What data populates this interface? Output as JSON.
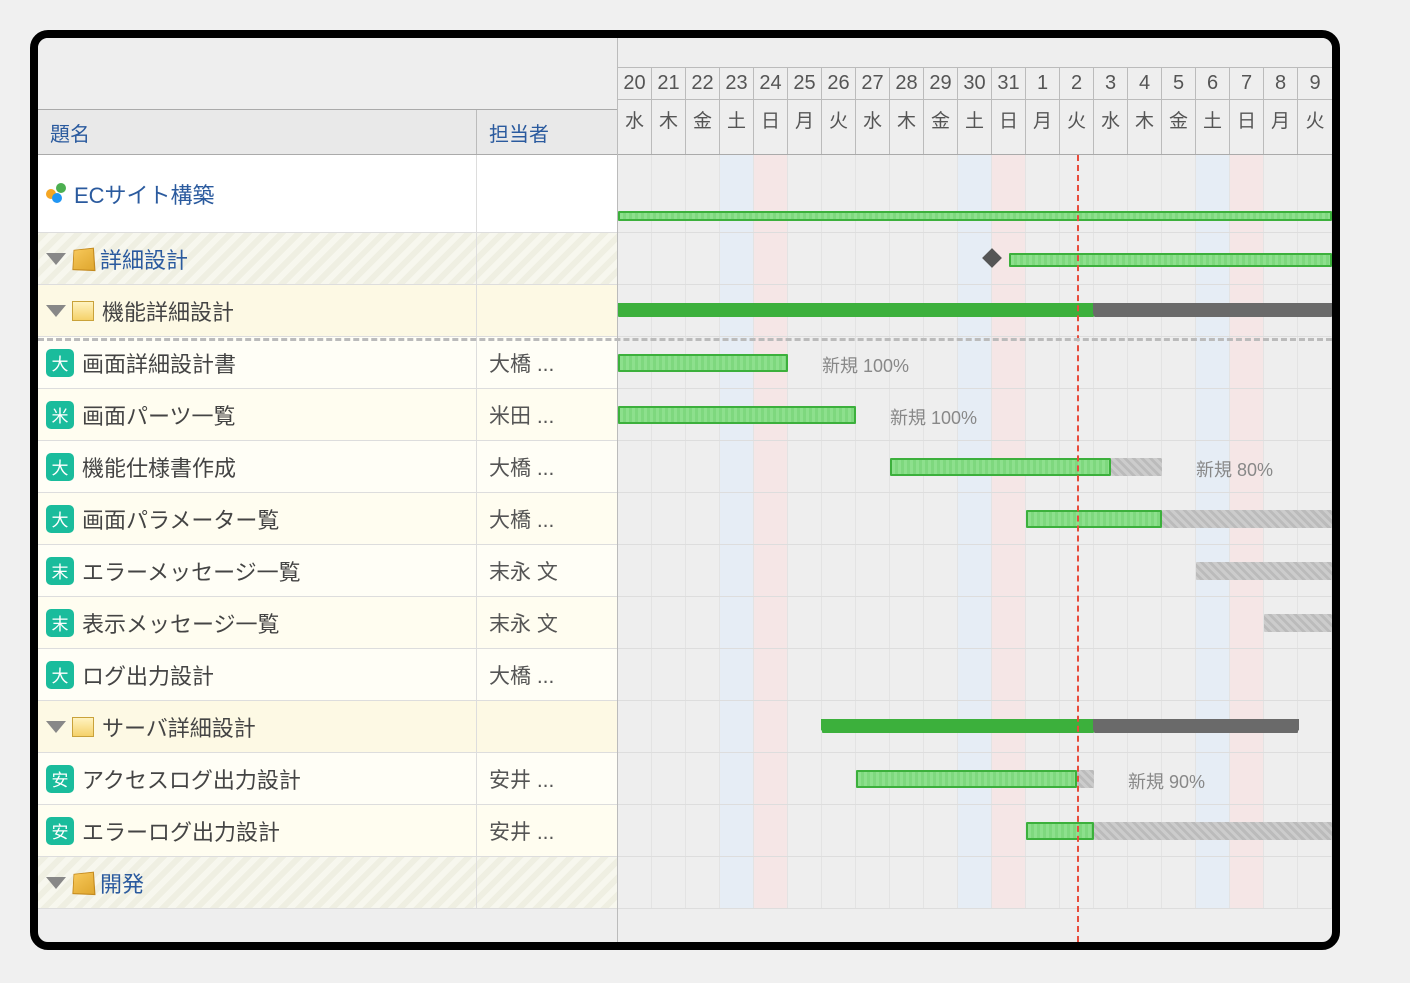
{
  "columns": {
    "title": "題名",
    "assignee": "担当者"
  },
  "project": {
    "name": "ECサイト構築"
  },
  "timeline": {
    "days": [
      {
        "num": "20",
        "lbl": "水",
        "wd": 3
      },
      {
        "num": "21",
        "lbl": "木",
        "wd": 4
      },
      {
        "num": "22",
        "lbl": "金",
        "wd": 5
      },
      {
        "num": "23",
        "lbl": "土",
        "wd": 6
      },
      {
        "num": "24",
        "lbl": "日",
        "wd": 0
      },
      {
        "num": "25",
        "lbl": "月",
        "wd": 1
      },
      {
        "num": "26",
        "lbl": "火",
        "wd": 2
      },
      {
        "num": "27",
        "lbl": "水",
        "wd": 3
      },
      {
        "num": "28",
        "lbl": "木",
        "wd": 4
      },
      {
        "num": "29",
        "lbl": "金",
        "wd": 5
      },
      {
        "num": "30",
        "lbl": "土",
        "wd": 6
      },
      {
        "num": "31",
        "lbl": "日",
        "wd": 0
      },
      {
        "num": "1",
        "lbl": "月",
        "wd": 1
      },
      {
        "num": "2",
        "lbl": "火",
        "wd": 2
      },
      {
        "num": "3",
        "lbl": "水",
        "wd": 3
      },
      {
        "num": "4",
        "lbl": "木",
        "wd": 4
      },
      {
        "num": "5",
        "lbl": "金",
        "wd": 5
      },
      {
        "num": "6",
        "lbl": "土",
        "wd": 6
      },
      {
        "num": "7",
        "lbl": "日",
        "wd": 0
      },
      {
        "num": "8",
        "lbl": "月",
        "wd": 1
      },
      {
        "num": "9",
        "lbl": "火",
        "wd": 2
      }
    ],
    "today_index": 13
  },
  "rows": [
    {
      "type": "group",
      "label": "詳細設計",
      "indent": 1
    },
    {
      "type": "subgroup",
      "label": "機能詳細設計",
      "indent": 2
    },
    {
      "type": "task",
      "label": "画面詳細設計書",
      "assignee": "大橋 ...",
      "badge": "大",
      "indent": 3
    },
    {
      "type": "task",
      "label": "画面パーツ一覧",
      "assignee": "米田 ...",
      "badge": "米",
      "indent": 3
    },
    {
      "type": "task",
      "label": "機能仕様書作成",
      "assignee": "大橋 ...",
      "badge": "大",
      "indent": 3
    },
    {
      "type": "task",
      "label": "画面パラメーター覧",
      "assignee": "大橋 ...",
      "badge": "大",
      "indent": 3
    },
    {
      "type": "task",
      "label": "エラーメッセージ一覧",
      "assignee": "末永 文",
      "badge": "末",
      "indent": 3
    },
    {
      "type": "task",
      "label": "表示メッセージ一覧",
      "assignee": "末永 文",
      "badge": "末",
      "indent": 3
    },
    {
      "type": "task",
      "label": "ログ出力設計",
      "assignee": "大橋 ...",
      "badge": "大",
      "indent": 3
    },
    {
      "type": "subgroup",
      "label": "サーバ詳細設計",
      "indent": 2
    },
    {
      "type": "task",
      "label": "アクセスログ出力設計",
      "assignee": "安井 ...",
      "badge": "安",
      "indent": 3
    },
    {
      "type": "task",
      "label": "エラーログ出力設計",
      "assignee": "安井 ...",
      "badge": "安",
      "indent": 3
    },
    {
      "type": "group",
      "label": "開発",
      "indent": 1
    }
  ],
  "statuses": {
    "s1": "新規 100%",
    "s2": "新規 100%",
    "s3": "新規 80%",
    "s4": "新規 90%"
  },
  "colors": {
    "badge": "#1abc9c",
    "green": "#3cb03c",
    "today": "#e74c3c"
  }
}
